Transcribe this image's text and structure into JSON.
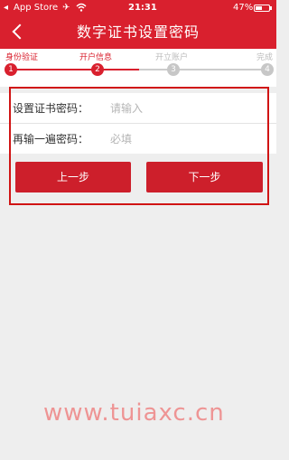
{
  "status_bar": {
    "back_glyph": "◂",
    "carrier": "App Store",
    "airplane_icon": "airplane-icon",
    "wifi_icon": "wifi-icon",
    "time": "21:31",
    "battery_percent": "47%",
    "battery_level": 0.47
  },
  "nav": {
    "title": "数字证书设置密码",
    "back_icon": "chevron-left-icon"
  },
  "steps": [
    {
      "label": "身份验证",
      "number": "1",
      "active": true
    },
    {
      "label": "开户信息",
      "number": "2",
      "active": true
    },
    {
      "label": "开立账户",
      "number": "3",
      "active": false
    },
    {
      "label": "完成",
      "number": "4",
      "active": false
    }
  ],
  "form": {
    "password_label": "设置证书密码：",
    "password_placeholder": "请输入",
    "confirm_label": "再输一遍密码：",
    "confirm_placeholder": "必填"
  },
  "buttons": {
    "prev_label": "上一步",
    "next_label": "下一步"
  },
  "watermark": "www.tuiaxc.cn",
  "colors": {
    "brand_red": "#d9202e",
    "button_red": "#cd1f2b",
    "background": "#eeeeee"
  }
}
